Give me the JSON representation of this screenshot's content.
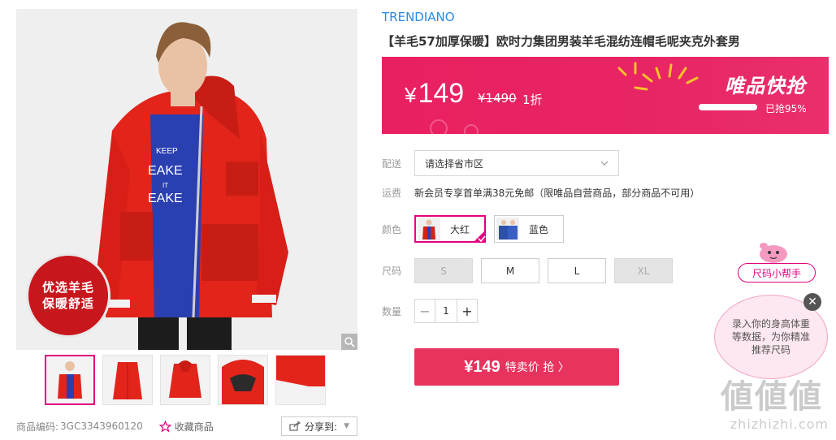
{
  "gallery": {
    "badge_line1": "优选羊毛",
    "badge_line2": "保暖舒适",
    "zoom_icon": "magnifier-icon",
    "thumbnails": [
      "model-front",
      "jacket-front",
      "jacket-back",
      "hood-detail",
      "cuff-detail"
    ]
  },
  "footer": {
    "sku_label": "商品编码:",
    "sku_code": "3GC3343960120",
    "favorite_label": "收藏商品",
    "share_label": "分享到:"
  },
  "product": {
    "brand": "TRENDIANO",
    "title": "【羊毛57加厚保暖】欧时力集团男装羊毛混纺连帽毛呢夹克外套男"
  },
  "price": {
    "currency": "¥",
    "current": "149",
    "original": "¥1490",
    "discount": "1折",
    "flash_title": "唯品快抢",
    "sold_text": "已抢95%",
    "sold_fraction": 0.95,
    "accent_color": "#e8205f"
  },
  "delivery": {
    "label": "配送",
    "placeholder": "请选择省市区"
  },
  "shipping": {
    "label": "运费",
    "text": "新会员专享首单满38元免邮（限唯品自营商品，部分商品不可用）"
  },
  "color": {
    "label": "颜色",
    "options": [
      {
        "name": "大红",
        "selected": true,
        "swatch": "#d6201c"
      },
      {
        "name": "蓝色",
        "selected": false,
        "swatch": "#2c4fb0"
      }
    ]
  },
  "size": {
    "label": "尺码",
    "options": [
      {
        "name": "S",
        "available": false
      },
      {
        "name": "M",
        "available": true
      },
      {
        "name": "L",
        "available": true
      },
      {
        "name": "XL",
        "available": false
      }
    ]
  },
  "quantity": {
    "label": "数量",
    "value": "1",
    "minus": "−",
    "plus": "+"
  },
  "buy": {
    "price": "¥149",
    "label": "特卖价 抢 〉"
  },
  "helper": {
    "pill_label": "尺码小帮手",
    "bubble_text": "录入你的身高体重等数据，为你精准推荐尺码",
    "close": "✕"
  },
  "watermark": {
    "top": "値値値",
    "bottom": "zhizhizhi.com"
  }
}
